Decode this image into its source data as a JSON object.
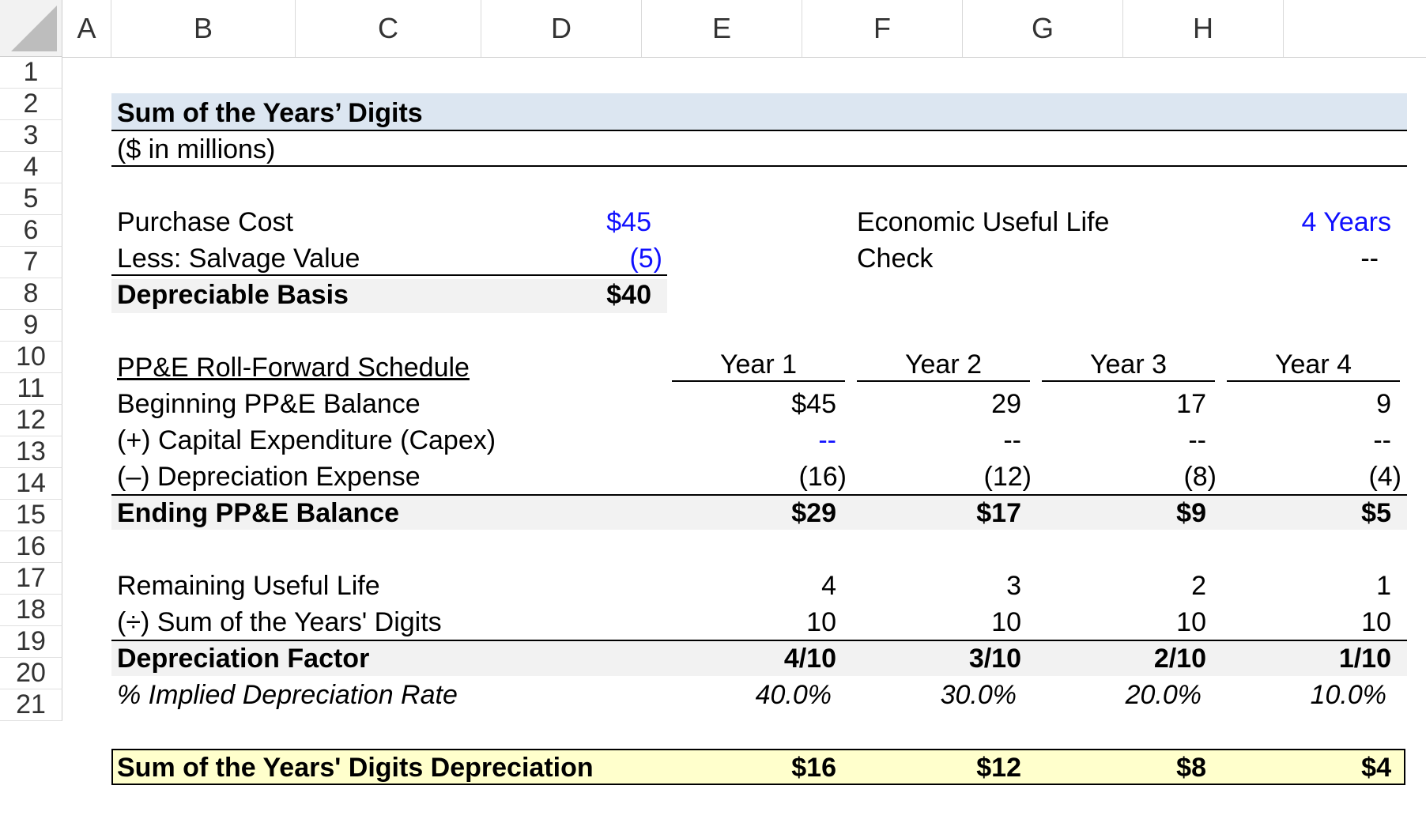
{
  "columns": [
    "A",
    "B",
    "C",
    "D",
    "E",
    "F",
    "G",
    "H"
  ],
  "rows": [
    "1",
    "2",
    "3",
    "4",
    "5",
    "6",
    "7",
    "8",
    "9",
    "10",
    "11",
    "12",
    "13",
    "14",
    "15",
    "16",
    "17",
    "18",
    "19",
    "20",
    "21"
  ],
  "title": "Sum of the Years’ Digits",
  "subtitle": "($ in millions)",
  "inputs": {
    "purchase_cost_label": "Purchase Cost",
    "purchase_cost_value": "$45",
    "salvage_label": "Less: Salvage Value",
    "salvage_value": "(5)",
    "basis_label": "Depreciable Basis",
    "basis_value": "$40",
    "life_label": "Economic Useful Life",
    "life_value": "4 Years",
    "check_label": "Check",
    "check_value": "--"
  },
  "schedule": {
    "header_label": "PP&E Roll-Forward Schedule",
    "years": [
      "Year 1",
      "Year 2",
      "Year 3",
      "Year 4"
    ],
    "rows": [
      {
        "label": "Beginning PP&E Balance",
        "values": [
          "$45",
          "29",
          "17",
          "9"
        ]
      },
      {
        "label": "(+) Capital Expenditure (Capex)",
        "values": [
          "--",
          "--",
          "--",
          "--"
        ]
      },
      {
        "label": "(–) Depreciation Expense",
        "values": [
          "(16)",
          "(12)",
          "(8)",
          "(4)"
        ]
      },
      {
        "label": "Ending PP&E Balance",
        "values": [
          "$29",
          "$17",
          "$9",
          "$5"
        ]
      }
    ]
  },
  "factors": {
    "rows": [
      {
        "label": "Remaining Useful Life",
        "values": [
          "4",
          "3",
          "2",
          "1"
        ]
      },
      {
        "label": "(÷) Sum of the Years' Digits",
        "values": [
          "10",
          "10",
          "10",
          "10"
        ]
      },
      {
        "label": "Depreciation Factor",
        "values": [
          "4/10",
          "3/10",
          "2/10",
          "1/10"
        ]
      },
      {
        "label": "% Implied Depreciation Rate",
        "values": [
          "40.0%",
          "30.0%",
          "20.0%",
          "10.0%"
        ]
      }
    ]
  },
  "result": {
    "label": "Sum of the Years' Digits Depreciation",
    "values": [
      "$16",
      "$12",
      "$8",
      "$4"
    ]
  },
  "colors": {
    "title_band": "#dce6f1",
    "total_band": "#f2f2f2",
    "result_band": "#ffffcc",
    "input_blue": "#1010ff",
    "header_bg": "#f2f2f2"
  }
}
